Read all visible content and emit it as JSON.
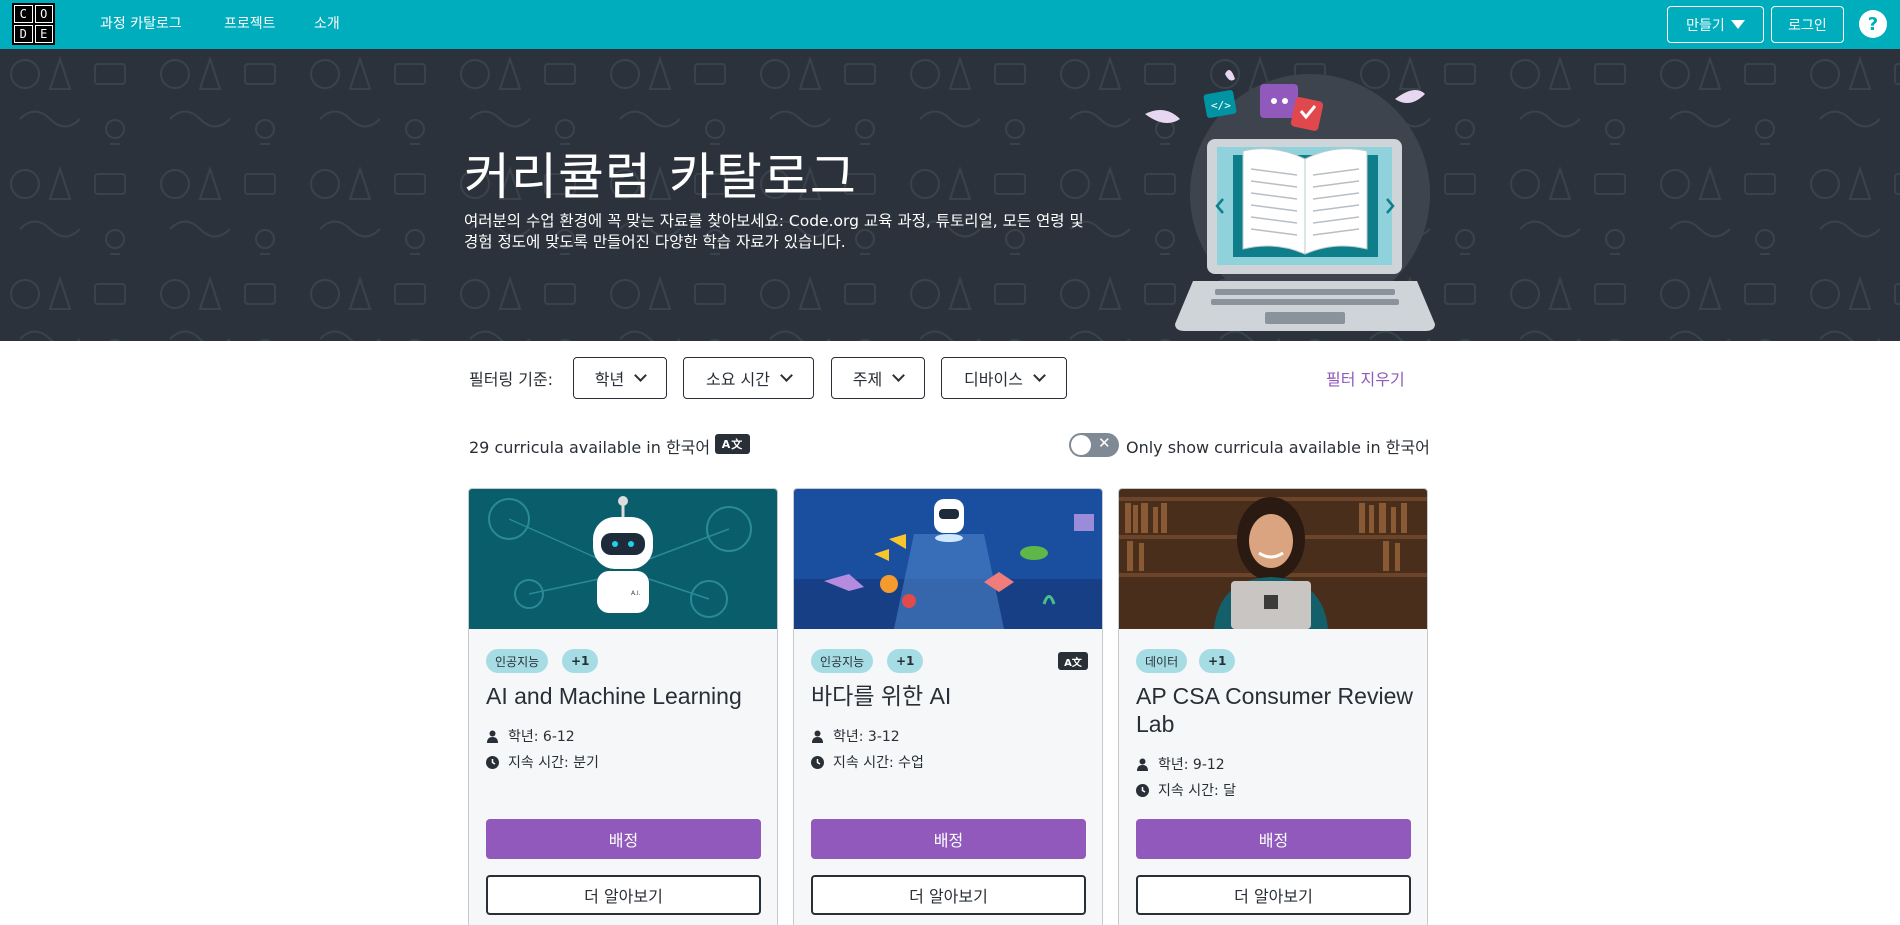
{
  "nav": {
    "logo_letters": [
      "C",
      "O",
      "D",
      "E"
    ],
    "links": [
      "과정 카탈로그",
      "프로젝트",
      "소개"
    ],
    "create_label": "만들기",
    "login_label": "로그인",
    "help_label": "?"
  },
  "hero": {
    "title": "커리큘럼 카탈로그",
    "description": "여러분의 수업 환경에 꼭 맞는 자료를 찾아보세요: Code.org 교육 과정, 튜토리얼, 모든 연령 및 경험 정도에 맞도록 만들어진 다양한 학습 자료가 있습니다."
  },
  "filters": {
    "label": "필터링 기준:",
    "buttons": [
      "학년",
      "소요 시간",
      "주제",
      "디바이스"
    ],
    "clear_label": "필터 지우기"
  },
  "results": {
    "count_text": "29 curricula available in 한국어",
    "lang_badge": "A文",
    "toggle_label": "Only show curricula available in 한국어",
    "toggle_on": false
  },
  "cards": [
    {
      "tag": "인공지능",
      "extra_tag": "+1",
      "title": "AI and Machine Learning",
      "grade": "학년: 6-12",
      "duration": "지속 시간: 분기",
      "assign_label": "배정",
      "learn_label": "더 알아보기",
      "show_lang_badge": false
    },
    {
      "tag": "인공지능",
      "extra_tag": "+1",
      "title": "바다를 위한 AI",
      "grade": "학년: 3-12",
      "duration": "지속 시간: 수업",
      "assign_label": "배정",
      "learn_label": "더 알아보기",
      "show_lang_badge": true
    },
    {
      "tag": "데이터",
      "extra_tag": "+1",
      "title": "AP CSA Consumer Review Lab",
      "grade": "학년: 9-12",
      "duration": "지속 시간: 달",
      "assign_label": "배정",
      "learn_label": "더 알아보기",
      "show_lang_badge": false
    }
  ],
  "colors": {
    "nav": "#00adbc",
    "hero_bg": "#2b323b",
    "accent_purple": "#9059bb",
    "tag_bg": "#a6dde5"
  }
}
